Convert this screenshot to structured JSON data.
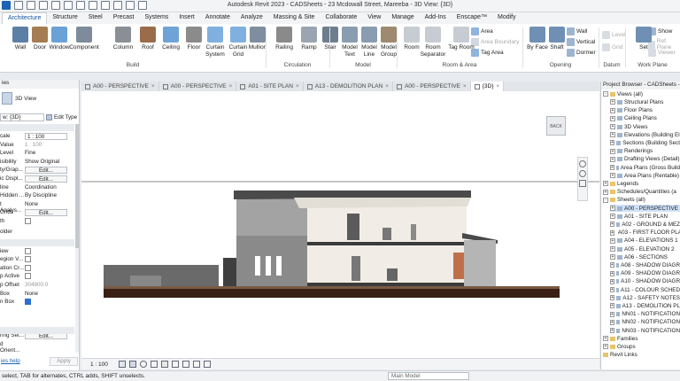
{
  "titlebar": {
    "title": "Autodesk Revit 2023 - CADSheets - 23 Mcdowall Street, Mareeba - 3D View: {3D}"
  },
  "ribbon_tabs": [
    "Architecture",
    "Structure",
    "Steel",
    "Precast",
    "Systems",
    "Insert",
    "Annotate",
    "Analyze",
    "Massing & Site",
    "Collaborate",
    "View",
    "Manage",
    "Add-Ins",
    "Enscape™",
    "Modify"
  ],
  "ribbon": {
    "buttons": [
      {
        "label": "Wall"
      },
      {
        "label": "Door"
      },
      {
        "label": "Window"
      },
      {
        "label": "Component"
      },
      {
        "label": "Column"
      },
      {
        "label": "Roof"
      },
      {
        "label": "Ceiling"
      },
      {
        "label": "Floor"
      },
      {
        "label": "Curtain System"
      },
      {
        "label": "Curtain Grid"
      },
      {
        "label": "Mullion"
      },
      {
        "label": "Railing"
      },
      {
        "label": "Ramp"
      },
      {
        "label": "Stair"
      },
      {
        "label": "Model Text"
      },
      {
        "label": "Model Line"
      },
      {
        "label": "Model Group"
      },
      {
        "label": "Room"
      },
      {
        "label": "Room Separator"
      },
      {
        "label": "Tag Room"
      },
      {
        "label": "By Face"
      },
      {
        "label": "Shaft"
      },
      {
        "label": "Set"
      }
    ],
    "small": {
      "area": "Area",
      "area_boundary": "Area Boundary",
      "tag_area": "Tag Area",
      "wall": "Wall",
      "vertical": "Vertical",
      "dormer": "Dormer",
      "level": "Level",
      "grid": "Grid",
      "show": "Show",
      "ref_plane": "Ref. Plane",
      "viewer": "Viewer"
    },
    "groups": [
      "Build",
      "Circulation",
      "Model",
      "Room & Area",
      "Opening",
      "Datum",
      "Work Plane"
    ]
  },
  "properties": {
    "header": "ies",
    "type": "3D View",
    "selector": "w: {3D}",
    "edit_type": "Edit Type",
    "rows": [
      {
        "k": "cale",
        "v": "1 : 100",
        "style": "boxed"
      },
      {
        "k": "Value",
        "v": "1 : 100",
        "style": "dim"
      },
      {
        "k": "Level",
        "v": "Fine",
        "style": "plain"
      },
      {
        "k": "isibility",
        "v": "Show Original",
        "style": "plain"
      },
      {
        "k": "ty/Grap...",
        "v": "Edit...",
        "style": "btn"
      },
      {
        "k": "ic Displ...",
        "v": "Edit...",
        "style": "btn"
      },
      {
        "k": "line",
        "v": "Coordination",
        "style": "plain"
      },
      {
        "k": "Hidden ...",
        "v": "By Discipline",
        "style": "plain"
      },
      {
        "k": "t Analys...",
        "v": "None",
        "style": "plain"
      },
      {
        "k": "Grids",
        "v": "Edit...",
        "style": "btn"
      },
      {
        "k": "th",
        "v": "",
        "style": "check"
      }
    ],
    "section2": "older",
    "rows2": [
      {
        "k": "iew",
        "v": "",
        "style": "check"
      },
      {
        "k": "egion V...",
        "v": "",
        "style": "check"
      },
      {
        "k": "ation Cr...",
        "v": "",
        "style": "check"
      },
      {
        "k": "p Active",
        "v": "",
        "style": "check"
      },
      {
        "k": "p Offset",
        "v": "304800.0",
        "style": "dim"
      },
      {
        "k": "Box",
        "v": "None",
        "style": "plain"
      },
      {
        "k": "n Box",
        "v": "",
        "style": "checkon"
      }
    ],
    "rows3": [
      {
        "k": "ring Set...",
        "v": "Edit...",
        "style": "btn"
      },
      {
        "k": "d Orient...",
        "v": "",
        "style": "plain"
      }
    ],
    "help": "ies help",
    "apply": "Apply"
  },
  "view_tabs": [
    {
      "label": "A00 - PERSPECTIVE",
      "active": false
    },
    {
      "label": "A00 - PERSPECTIVE",
      "active": false
    },
    {
      "label": "A01 - SITE PLAN",
      "active": false
    },
    {
      "label": "A13 - DEMOLITION PLAN",
      "active": false
    },
    {
      "label": "A00 - PERSPECTIVE",
      "active": false
    },
    {
      "label": "{3D}",
      "active": true
    }
  ],
  "canvas": {
    "viewcube_label": "BACK"
  },
  "viewbar": {
    "scale": "1 : 100"
  },
  "browser": {
    "header": "Project Browser - CADSheets - 2...",
    "items": [
      {
        "label": "Views (all)",
        "indent": 0,
        "toggle": "-"
      },
      {
        "label": "Structural Plans",
        "indent": 1,
        "toggle": "+"
      },
      {
        "label": "Floor Plans",
        "indent": 1,
        "toggle": "+"
      },
      {
        "label": "Ceiling Plans",
        "indent": 1,
        "toggle": "+"
      },
      {
        "label": "3D Views",
        "indent": 1,
        "toggle": "+"
      },
      {
        "label": "Elevations (Building El",
        "indent": 1,
        "toggle": "+"
      },
      {
        "label": "Sections (Building Sect",
        "indent": 1,
        "toggle": "+"
      },
      {
        "label": "Renderings",
        "indent": 1,
        "toggle": "+"
      },
      {
        "label": "Drafting Views (Detail)",
        "indent": 1,
        "toggle": "+"
      },
      {
        "label": "Area Plans (Gross Build",
        "indent": 1,
        "toggle": "+"
      },
      {
        "label": "Area Plans (Rentable)",
        "indent": 1,
        "toggle": "+"
      },
      {
        "label": "Legends",
        "indent": 0,
        "toggle": "+"
      },
      {
        "label": "Schedules/Quantities (a",
        "indent": 0,
        "toggle": "+"
      },
      {
        "label": "Sheets (all)",
        "indent": 0,
        "toggle": "-"
      },
      {
        "label": "A00 - PERSPECTIVE",
        "indent": 1,
        "toggle": "+",
        "selected": true
      },
      {
        "label": "A01 - SITE PLAN",
        "indent": 1,
        "toggle": "+"
      },
      {
        "label": "A02 - GROUND & MEZ",
        "indent": 1,
        "toggle": "+"
      },
      {
        "label": "A03 - FIRST FLOOR PLA",
        "indent": 1,
        "toggle": "+"
      },
      {
        "label": "A04 - ELEVATIONS 1",
        "indent": 1,
        "toggle": "+"
      },
      {
        "label": "A05 - ELEVATION 2",
        "indent": 1,
        "toggle": "+"
      },
      {
        "label": "A06 - SECTIONS",
        "indent": 1,
        "toggle": "+"
      },
      {
        "label": "A08 - SHADOW DIAGR",
        "indent": 1,
        "toggle": "+"
      },
      {
        "label": "A09 - SHADOW DIAGR",
        "indent": 1,
        "toggle": "+"
      },
      {
        "label": "A10 - SHADOW DIAGR",
        "indent": 1,
        "toggle": "+"
      },
      {
        "label": "A11 - COLOUR SCHED",
        "indent": 1,
        "toggle": "+"
      },
      {
        "label": "A12 - SAFETY NOTES",
        "indent": 1,
        "toggle": "+"
      },
      {
        "label": "A13 - DEMOLITION PL",
        "indent": 1,
        "toggle": "+"
      },
      {
        "label": "NN01 - NOTIFICATION",
        "indent": 1,
        "toggle": "+"
      },
      {
        "label": "NN02 - NOTIFICATION",
        "indent": 1,
        "toggle": "+"
      },
      {
        "label": "NN03 - NOTIFICATION",
        "indent": 1,
        "toggle": "+"
      },
      {
        "label": "Families",
        "indent": 0,
        "toggle": "+"
      },
      {
        "label": "Groups",
        "indent": 0,
        "toggle": "+"
      },
      {
        "label": "Revit Links",
        "indent": 0,
        "toggle": ""
      }
    ]
  },
  "statusbar": {
    "message": "select, TAB for alternates, CTRL adds, SHIFT unselects.",
    "model": "Main Model"
  },
  "colors": {
    "accent": "#0b4f9c",
    "selection": "#cfe1f7"
  }
}
